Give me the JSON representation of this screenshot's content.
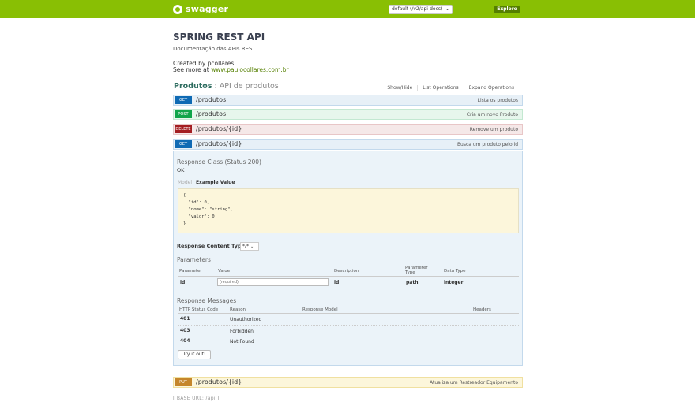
{
  "header": {
    "logo_text": "swagger",
    "spec_select": "default (/v2/api-docs)",
    "explore_label": "Explore",
    "colors": {
      "bar": "#89bf04"
    }
  },
  "info": {
    "title": "SPRING REST API",
    "description": "Documentação das APIs REST",
    "created_by": "Created by pcollares",
    "see_more_prefix": "See more at",
    "see_more_link": "www.paulocollares.com.br"
  },
  "resource": {
    "name": "Produtos",
    "separator": " : ",
    "subtitle": "API de produtos",
    "links": [
      "Show/Hide",
      "List Operations",
      "Expand Operations"
    ]
  },
  "operations": [
    {
      "method": "GET",
      "path": "/produtos",
      "summary": "Lista os produtos"
    },
    {
      "method": "POST",
      "path": "/produtos",
      "summary": "Cria um novo Produto"
    },
    {
      "method": "DELETE",
      "path": "/produtos/{id}",
      "summary": "Remove um produto"
    },
    {
      "method": "GET",
      "path": "/produtos/{id}",
      "summary": "Busca um produto pelo id"
    },
    {
      "method": "PUT",
      "path": "/produtos/{id}",
      "summary": "Atualiza um Restreador Equipamento"
    }
  ],
  "expanded": {
    "response_class_title": "Response Class (Status 200)",
    "response_class_value": "OK",
    "tab_model": "Model",
    "tab_example": "Example Value",
    "example_code": "{\n  \"id\": 0,\n  \"nome\": \"string\",\n  \"valor\": 0\n}",
    "response_content_type_label": "Response Content Type",
    "response_content_type_value": "*/*",
    "parameters_title": "Parameters",
    "param_headers": [
      "Parameter",
      "Value",
      "Description",
      "Parameter Type",
      "Data Type"
    ],
    "param_row": {
      "name": "id",
      "placeholder": "(required)",
      "description": "id",
      "type": "path",
      "data_type": "integer"
    },
    "messages_title": "Response Messages",
    "msg_headers": [
      "HTTP Status Code",
      "Reason",
      "Response Model",
      "Headers"
    ],
    "messages": [
      {
        "code": "401",
        "reason": "Unauthorized"
      },
      {
        "code": "403",
        "reason": "Forbidden"
      },
      {
        "code": "404",
        "reason": "Not Found"
      }
    ],
    "try_button": "Try it out!"
  },
  "footer": {
    "base_url": "[ BASE URL: /api ]"
  }
}
